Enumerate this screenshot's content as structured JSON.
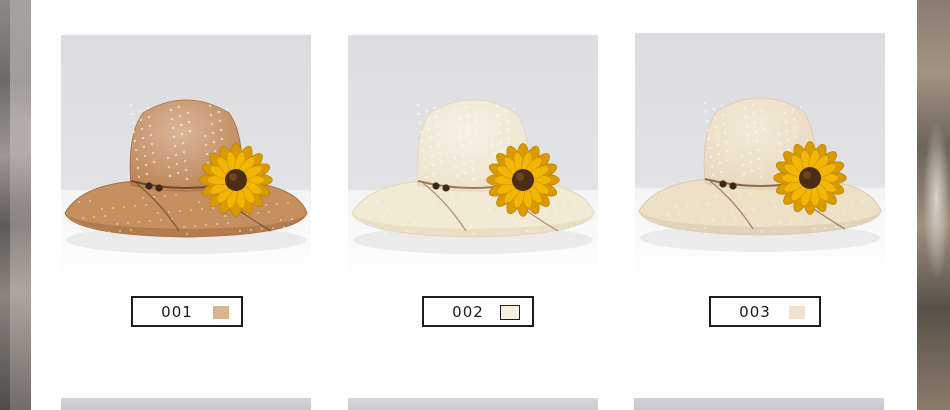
{
  "products": [
    {
      "code": "001",
      "swatch_color": "#d9b48e",
      "swatch_border": "none",
      "hat_color": "#c68f60",
      "hat_shade": "#a86f43",
      "band_color": "#6b4a2e",
      "background": "#dcdcdf",
      "icon": "sunflower-straw-hat"
    },
    {
      "code": "002",
      "swatch_color": "#f7efe1",
      "swatch_border": "#1d1d1d",
      "hat_color": "#f3ead6",
      "hat_shade": "#e2d5ba",
      "band_color": "#9b7a56",
      "background": "#dedde2",
      "icon": "sunflower-straw-hat"
    },
    {
      "code": "003",
      "swatch_color": "#f0e2cf",
      "swatch_border": "none",
      "hat_color": "#eedfc7",
      "hat_shade": "#dccab0",
      "band_color": "#8a6a4b",
      "background": "#dcdbe0",
      "icon": "sunflower-straw-hat"
    }
  ],
  "colors": {
    "label_border": "#1d1d1d",
    "sunflower_petal": "#f2b705",
    "sunflower_petal_dark": "#d99a00",
    "sunflower_center": "#4b2e12"
  }
}
